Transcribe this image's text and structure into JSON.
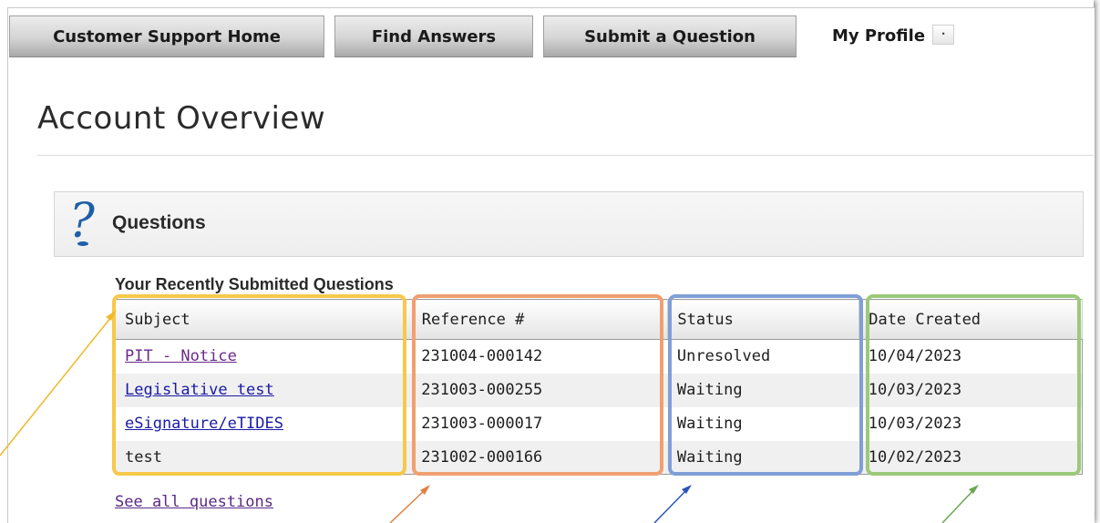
{
  "nav": {
    "tabs": [
      {
        "label": "Customer Support Home",
        "active": false
      },
      {
        "label": "Find Answers",
        "active": false
      },
      {
        "label": "Submit a Question",
        "active": false
      },
      {
        "label": "My Profile",
        "active": true,
        "dropdown_icon": "chevron-down-icon"
      }
    ]
  },
  "page": {
    "title": "Account Overview"
  },
  "questions_panel": {
    "icon": "question-mark-icon",
    "heading": "Questions"
  },
  "recent": {
    "heading": "Your Recently Submitted Questions",
    "columns": [
      "Subject",
      "Reference #",
      "Status",
      "Date Created"
    ],
    "rows": [
      {
        "subject": "PIT - Notice",
        "reference": "231004-000142",
        "status": "Unresolved",
        "date": "10/04/2023",
        "visited": true
      },
      {
        "subject": "Legislative test",
        "reference": "231003-000255",
        "status": "Waiting",
        "date": "10/03/2023",
        "visited": false
      },
      {
        "subject": "eSignature/eTIDES",
        "reference": "231003-000017",
        "status": "Waiting",
        "date": "10/03/2023",
        "visited": false
      },
      {
        "subject": "test",
        "reference": "231002-000166",
        "status": "Waiting",
        "date": "10/02/2023",
        "visited": false
      }
    ],
    "see_all_label": "See all questions"
  },
  "annotations": {
    "colors": {
      "subject": "#f6c94a",
      "reference": "#f0a070",
      "status": "#7f9fd6",
      "date": "#9cc97a"
    }
  }
}
